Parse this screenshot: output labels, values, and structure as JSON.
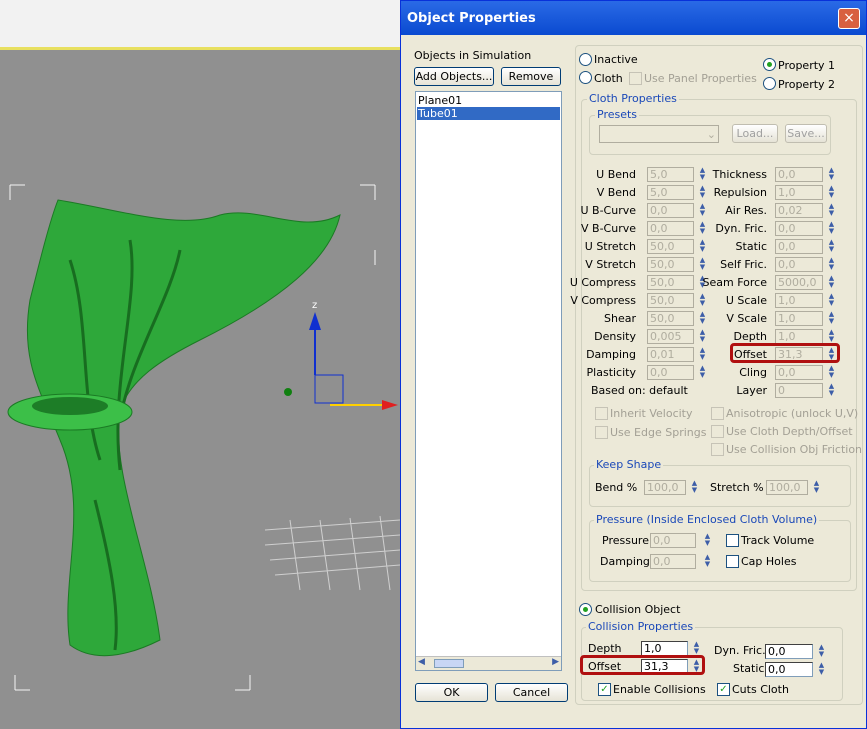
{
  "dialog": {
    "title": "Object Properties",
    "close": "×"
  },
  "objects": {
    "label": "Objects in Simulation",
    "add": "Add Objects...",
    "remove": "Remove",
    "items": [
      "Plane01",
      "Tube01"
    ],
    "selected": "Tube01",
    "ok": "OK",
    "cancel": "Cancel"
  },
  "mode": {
    "inactive": "Inactive",
    "cloth": "Cloth",
    "use_panel": "Use Panel Properties",
    "property1": "Property 1",
    "property2": "Property 2",
    "collision_object": "Collision Object",
    "selected": "Collision Object",
    "selected_property": "Property 1"
  },
  "cloth_properties": {
    "title": "Cloth Properties",
    "presets_title": "Presets",
    "load": "Load...",
    "save": "Save...",
    "left": [
      [
        "U Bend",
        "5,0"
      ],
      [
        "V Bend",
        "5,0"
      ],
      [
        "U B-Curve",
        "0,0"
      ],
      [
        "V B-Curve",
        "0,0"
      ],
      [
        "U Stretch",
        "50,0"
      ],
      [
        "V Stretch",
        "50,0"
      ],
      [
        "U Compress",
        "50,0"
      ],
      [
        "V Compress",
        "50,0"
      ],
      [
        "Shear",
        "50,0"
      ],
      [
        "Density",
        "0,005"
      ],
      [
        "Damping",
        "0,01"
      ],
      [
        "Plasticity",
        "0,0"
      ]
    ],
    "right": [
      [
        "Thickness",
        "0,0"
      ],
      [
        "Repulsion",
        "1,0"
      ],
      [
        "Air Res.",
        "0,02"
      ],
      [
        "Dyn. Fric.",
        "0,0"
      ],
      [
        "Static",
        "0,0"
      ],
      [
        "Self Fric.",
        "0,0"
      ],
      [
        "Seam Force",
        "5000,0"
      ],
      [
        "U Scale",
        "1,0"
      ],
      [
        "V Scale",
        "1,0"
      ],
      [
        "Depth",
        "1,0"
      ],
      [
        "Offset",
        "31,3"
      ],
      [
        "Cling",
        "0,0"
      ],
      [
        "Layer",
        "0"
      ]
    ],
    "based_on": "Based on: default",
    "checks": [
      "Inherit Velocity",
      "Use Edge Springs",
      "Anisotropic (unlock U,V)",
      "Use Cloth Depth/Offset",
      "Use Collision Obj Friction"
    ],
    "keep_shape": {
      "title": "Keep Shape",
      "bend_label": "Bend %",
      "bend": "100,0",
      "stretch_label": "Stretch %",
      "stretch": "100,0"
    },
    "pressure": {
      "title": "Pressure (Inside Enclosed Cloth Volume)",
      "pressure_label": "Pressure",
      "pressure": "0,0",
      "damping_label": "Damping",
      "damping": "0,0",
      "track_volume": "Track Volume",
      "cap_holes": "Cap Holes"
    }
  },
  "collision": {
    "title": "Collision Properties",
    "depth_label": "Depth",
    "depth": "1,0",
    "offset_label": "Offset",
    "offset": "31,3",
    "dyn_fric_label": "Dyn. Fric.",
    "dyn_fric": "0,0",
    "static_label": "Static",
    "static": "0,0",
    "enable_collisions": "Enable Collisions",
    "cuts_cloth": "Cuts Cloth"
  },
  "viewport": {
    "axis_z": "z"
  },
  "colors": {
    "title_bar": "#0a4ad0",
    "accent_red": "#b01010",
    "cloth_green": "#2ea83a"
  }
}
